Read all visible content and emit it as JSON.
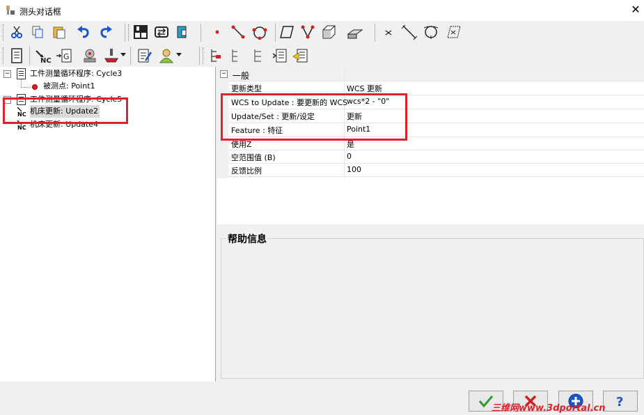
{
  "window": {
    "title": "测头对话框"
  },
  "tree": {
    "items": [
      {
        "label": "工件测量循环程序: Cycle3",
        "icon": "document-icon"
      },
      {
        "label": "被测点: Point1",
        "icon": "point-icon"
      },
      {
        "label": "工件测量循环程序: Cycle5",
        "icon": "document-icon"
      },
      {
        "label": "机床更新: Update2",
        "icon": "nc-icon"
      },
      {
        "label": "机床更新: Update4",
        "icon": "nc-icon"
      }
    ]
  },
  "properties": {
    "category": "一般",
    "rows": [
      {
        "name": "更新类型",
        "value": "WCS 更新"
      },
      {
        "name": "WCS to Update : 要更新的 WCS",
        "value": "wcs*2 - \"0\""
      },
      {
        "name": "Update/Set : 更新/设定",
        "value": "更新"
      },
      {
        "name": "Feature : 特征",
        "value": "Point1"
      },
      {
        "name": "使用Z",
        "value": "是"
      },
      {
        "name": "空范围值 (B)",
        "value": "0"
      },
      {
        "name": "反馈比例",
        "value": "100"
      }
    ]
  },
  "help": {
    "title": "帮助信息"
  },
  "watermark": "三维网www.3dportal.cn",
  "colors": {
    "highlight_box": "#e0202a",
    "toolbar_blue": "#1a56c8"
  }
}
